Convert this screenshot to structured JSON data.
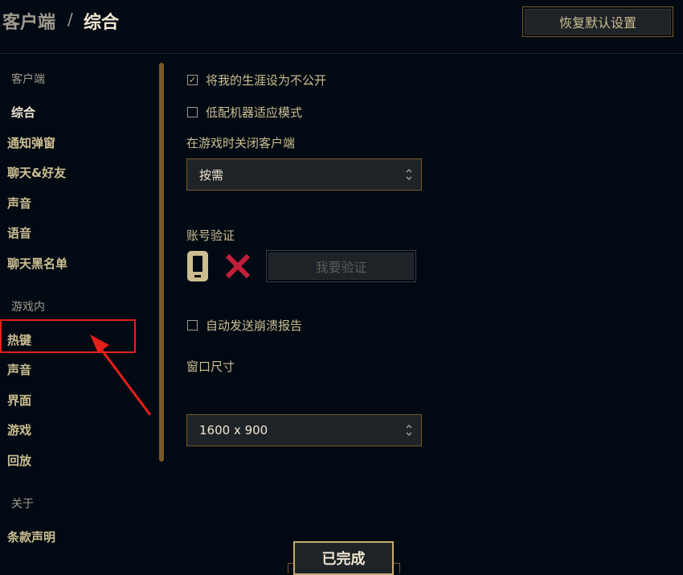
{
  "header": {
    "breadcrumb_parent": "客户端",
    "breadcrumb_separator": "/",
    "breadcrumb_current": "综合",
    "reset_label": "恢复默认设置"
  },
  "sidebar": {
    "sections": [
      {
        "title": "客户端",
        "items": [
          "综合",
          "通知弹窗",
          "聊天&好友",
          "声音",
          "语音",
          "聊天黑名单"
        ]
      },
      {
        "title": "游戏内",
        "items": [
          "热键",
          "声音",
          "界面",
          "游戏",
          "回放"
        ]
      },
      {
        "title": "关于",
        "items": [
          "条款声明"
        ]
      }
    ],
    "active_item": "综合",
    "highlighted_item": "热键"
  },
  "main": {
    "private_career": {
      "label": "将我的生涯设为不公开",
      "checked": true
    },
    "low_spec_mode": {
      "label": "低配机器适应模式",
      "checked": false
    },
    "close_client_label": "在游戏时关闭客户端",
    "close_client_value": "按需",
    "account_verify_label": "账号验证",
    "phone_icon": "phone-icon",
    "status_icon": "red-x-icon",
    "verify_button": "我要验证",
    "crash_report": {
      "label": "自动发送崩溃报告",
      "checked": false
    },
    "window_size_label": "窗口尺寸",
    "window_size_value": "1600 x 900"
  },
  "footer": {
    "done_label": "已完成"
  },
  "colors": {
    "background": "#010a13",
    "gold": "#c8aa6e",
    "text": "#cdbe91",
    "annotation_red": "#e5201a",
    "x_red": "#c21f3a"
  }
}
